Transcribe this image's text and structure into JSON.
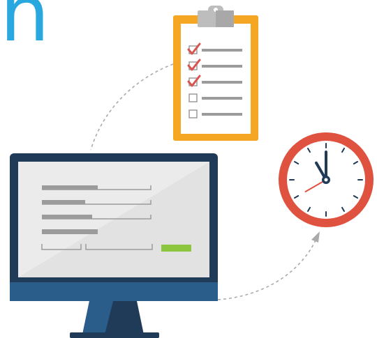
{
  "title_fragment": "n",
  "colors": {
    "accent_blue": "#29a8e0",
    "monitor_frame": "#1f3b57",
    "monitor_bezel": "#2a5d8a",
    "screen": "#ebebeb",
    "field_bar": "#9b9b9b",
    "submit_green": "#8cc63f",
    "clipboard_board": "#f5a623",
    "clipboard_paper": "#ffffff",
    "clip": "#bdbdbd",
    "check_red": "#d9534f",
    "clock_rim": "#e05240",
    "clock_hand": "#1f3b57",
    "second_hand": "#e05240",
    "dashed_path": "#aaaaaa"
  },
  "clipboard": {
    "items": [
      {
        "checked": true
      },
      {
        "checked": true
      },
      {
        "checked": true
      },
      {
        "checked": false
      },
      {
        "checked": false
      }
    ]
  },
  "clock": {
    "hour": 11,
    "minute": 0
  },
  "icons": [
    "monitor-icon",
    "clipboard-icon",
    "clock-icon",
    "checkmark-icon",
    "arrow-icon"
  ]
}
